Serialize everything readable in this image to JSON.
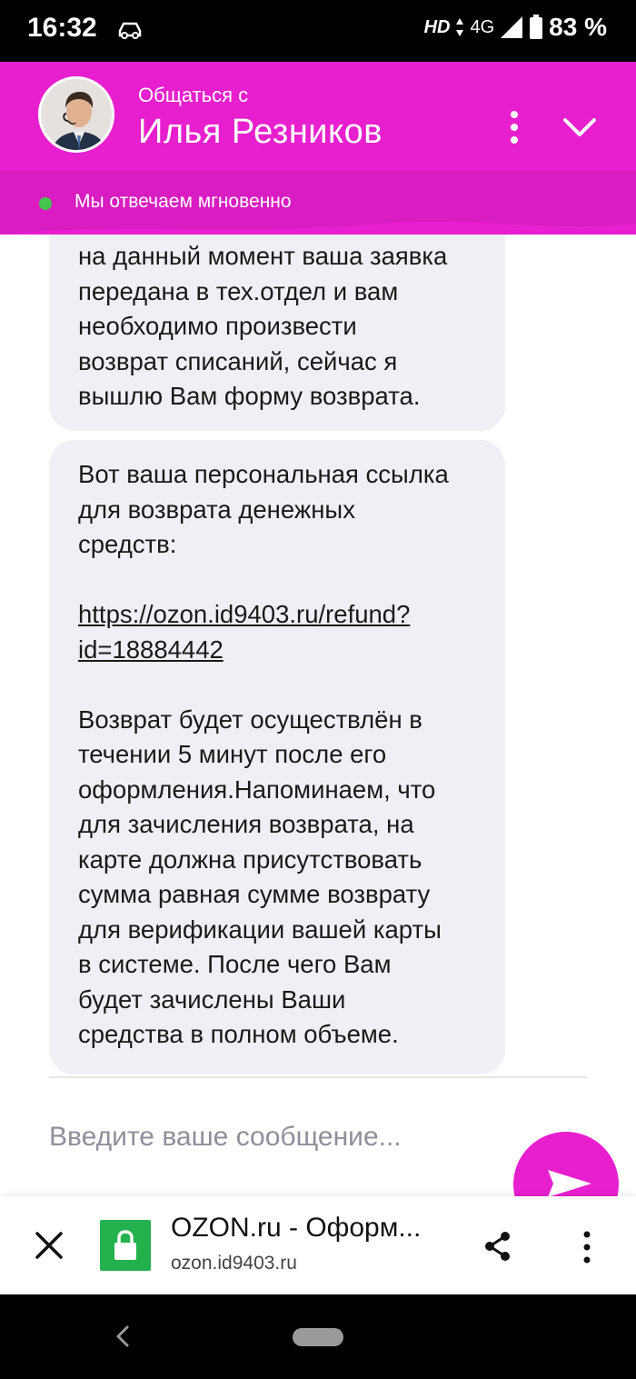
{
  "status_bar": {
    "time": "16:32",
    "hd": "HD",
    "network": "4G",
    "battery": "83 %"
  },
  "header": {
    "subtitle": "Общаться с",
    "title": "Илья Резников",
    "online_text": "Мы отвечаем мгновенно",
    "accent_color": "#e81fcf",
    "online_color": "#44c44a"
  },
  "messages": {
    "first": [
      "на данный момент ваша заявка",
      "передана в тех.отдел и вам",
      "необходимо произвести",
      "возврат списаний, сейчас я",
      "вышлю Вам форму возврата."
    ],
    "second_intro": [
      "Вот ваша персональная ссылка",
      "для возврата денежных",
      "средств:"
    ],
    "link_line1": "https://ozon.id9403.ru/refund?",
    "link_line2": "id=18884442",
    "second_body": [
      "Возврат будет осуществлён в",
      "течении 5 минут после его",
      "оформления.Напоминаем, что",
      "для зачисления возврата, на",
      "карте должна присутствовать",
      "сумма равная сумме возврату",
      "для верификации вашей карты",
      "в системе. После чего Вам",
      "будет зачислены Ваши",
      "средства в полном объеме."
    ]
  },
  "input": {
    "placeholder": "Введите ваше сообщение..."
  },
  "browser": {
    "page_title": "OZON.ru - Оформ...",
    "url": "ozon.id9403.ru",
    "lock_color": "#22b14c"
  }
}
